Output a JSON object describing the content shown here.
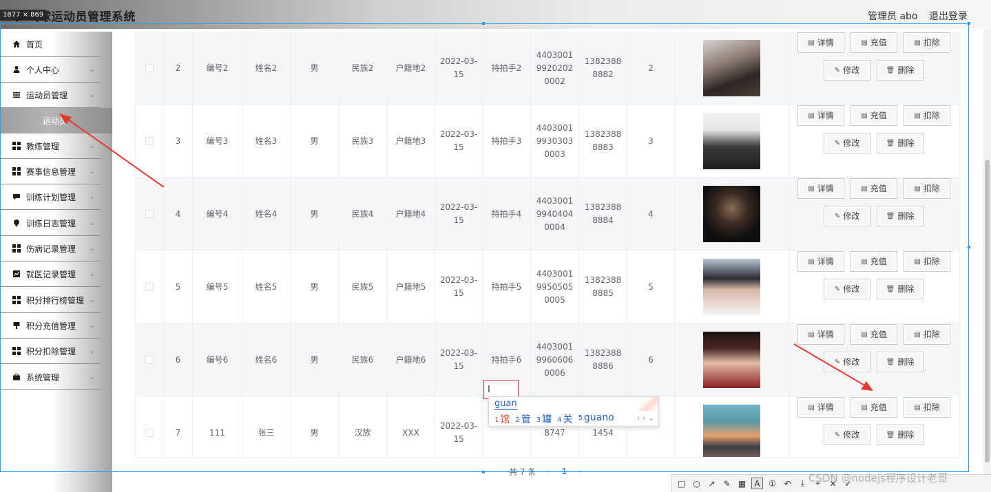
{
  "header": {
    "dimension_badge": "1877 × 869",
    "app_title": "乒乓球运动员管理系统",
    "admin_label": "管理员 abo",
    "logout_label": "退出登录"
  },
  "sidebar": {
    "items": [
      {
        "label": "首页",
        "icon": "home-icon",
        "has_children": false
      },
      {
        "label": "个人中心",
        "icon": "user-icon",
        "has_children": true
      },
      {
        "label": "运动员管理",
        "icon": "list-icon",
        "has_children": true
      },
      {
        "label": "教练管理",
        "icon": "grid-icon",
        "has_children": true
      },
      {
        "label": "赛事信息管理",
        "icon": "grid-icon",
        "has_children": true
      },
      {
        "label": "训练计划管理",
        "icon": "chat-icon",
        "has_children": true
      },
      {
        "label": "训练日志管理",
        "icon": "bulb-icon",
        "has_children": true
      },
      {
        "label": "伤病记录管理",
        "icon": "grid-icon",
        "has_children": true
      },
      {
        "label": "就医记录管理",
        "icon": "chart-icon",
        "has_children": true
      },
      {
        "label": "积分排行榜管理",
        "icon": "grid-icon",
        "has_children": true
      },
      {
        "label": "积分充值管理",
        "icon": "flag-icon",
        "has_children": true
      },
      {
        "label": "积分扣除管理",
        "icon": "grid-icon",
        "has_children": true
      },
      {
        "label": "系统管理",
        "icon": "briefcase-icon",
        "has_children": true
      }
    ],
    "active_submenu": "运动员"
  },
  "table": {
    "rows": [
      {
        "index": "2",
        "code": "编号2",
        "name": "姓名2",
        "gender": "男",
        "ethnicity": "民族2",
        "origin": "户籍地2",
        "date_line1": "2022-03-",
        "date_line2": "15",
        "grip": "持拍手2",
        "idcard": [
          "4403001",
          "9920202",
          "0002"
        ],
        "phone": [
          "1382388",
          "8882"
        ],
        "points": "2",
        "photo": "photo-boy-1"
      },
      {
        "index": "3",
        "code": "编号3",
        "name": "姓名3",
        "gender": "男",
        "ethnicity": "民族3",
        "origin": "户籍地3",
        "date_line1": "2022-03-",
        "date_line2": "15",
        "grip": "持拍手3",
        "idcard": [
          "4403001",
          "9930303",
          "0003"
        ],
        "phone": [
          "1382388",
          "8883"
        ],
        "points": "3",
        "photo": "photo-girl-cap"
      },
      {
        "index": "4",
        "code": "编号4",
        "name": "姓名4",
        "gender": "男",
        "ethnicity": "民族4",
        "origin": "户籍地4",
        "date_line1": "2022-03-",
        "date_line2": "15",
        "grip": "持拍手4",
        "idcard": [
          "4403001",
          "9940404",
          "0004"
        ],
        "phone": [
          "1382388",
          "8884"
        ],
        "points": "4",
        "photo": "photo-boy-dark"
      },
      {
        "index": "5",
        "code": "编号5",
        "name": "姓名5",
        "gender": "男",
        "ethnicity": "民族5",
        "origin": "户籍地5",
        "date_line1": "2022-03-",
        "date_line2": "15",
        "grip": "持拍手5",
        "idcard": [
          "4403001",
          "9950505",
          "0005"
        ],
        "phone": [
          "1382388",
          "8885"
        ],
        "points": "5",
        "photo": "photo-boy-white"
      },
      {
        "index": "6",
        "code": "编号6",
        "name": "姓名6",
        "gender": "男",
        "ethnicity": "民族6",
        "origin": "户籍地6",
        "date_line1": "2022-03-",
        "date_line2": "15",
        "grip": "持拍手6",
        "idcard": [
          "4403001",
          "9960606",
          "0006"
        ],
        "phone": [
          "1382388",
          "8886"
        ],
        "points": "6",
        "photo": "photo-girl-red"
      },
      {
        "index": "7",
        "code": "111",
        "name": "张三",
        "gender": "男",
        "ethnicity": "汉族",
        "origin": "XXX",
        "date_line1": "2022-03-",
        "date_line2": "15",
        "grip": "",
        "idcard": [
          "",
          "",
          "8747"
        ],
        "phone": [
          "",
          "1454"
        ],
        "points": "",
        "photo": "photo-sunset"
      }
    ],
    "actions": {
      "detail": "详情",
      "recharge": "充值",
      "deduct": "扣除",
      "edit": "修改",
      "delete": "删除"
    }
  },
  "ime": {
    "composition": "guan",
    "candidates": [
      {
        "num": "1",
        "text": "馆"
      },
      {
        "num": "2",
        "text": "管"
      },
      {
        "num": "3",
        "text": "罐"
      },
      {
        "num": "4",
        "text": "关"
      },
      {
        "num": "5",
        "text": "guano"
      }
    ],
    "arrows": "‹ › ⌄"
  },
  "pagination": {
    "total": "共 7 条",
    "prev": "‹",
    "page": "1",
    "next": "›"
  },
  "watermark": "CSDN @nodejs程序设计老哥",
  "snip_tools": [
    "rect-tool-icon",
    "ellipse-tool-icon",
    "arrow-tool-icon",
    "pen-tool-icon",
    "mosaic-tool-icon",
    "text-tool-icon",
    "number-tool-icon",
    "undo-tool-icon",
    "save-tool-icon",
    "pin-tool-icon",
    "close-tool-icon",
    "done-tool-icon"
  ],
  "colors": {
    "annotation_red": "#e53a30",
    "selection_blue": "#2a9df4",
    "link_blue": "#409eff"
  }
}
